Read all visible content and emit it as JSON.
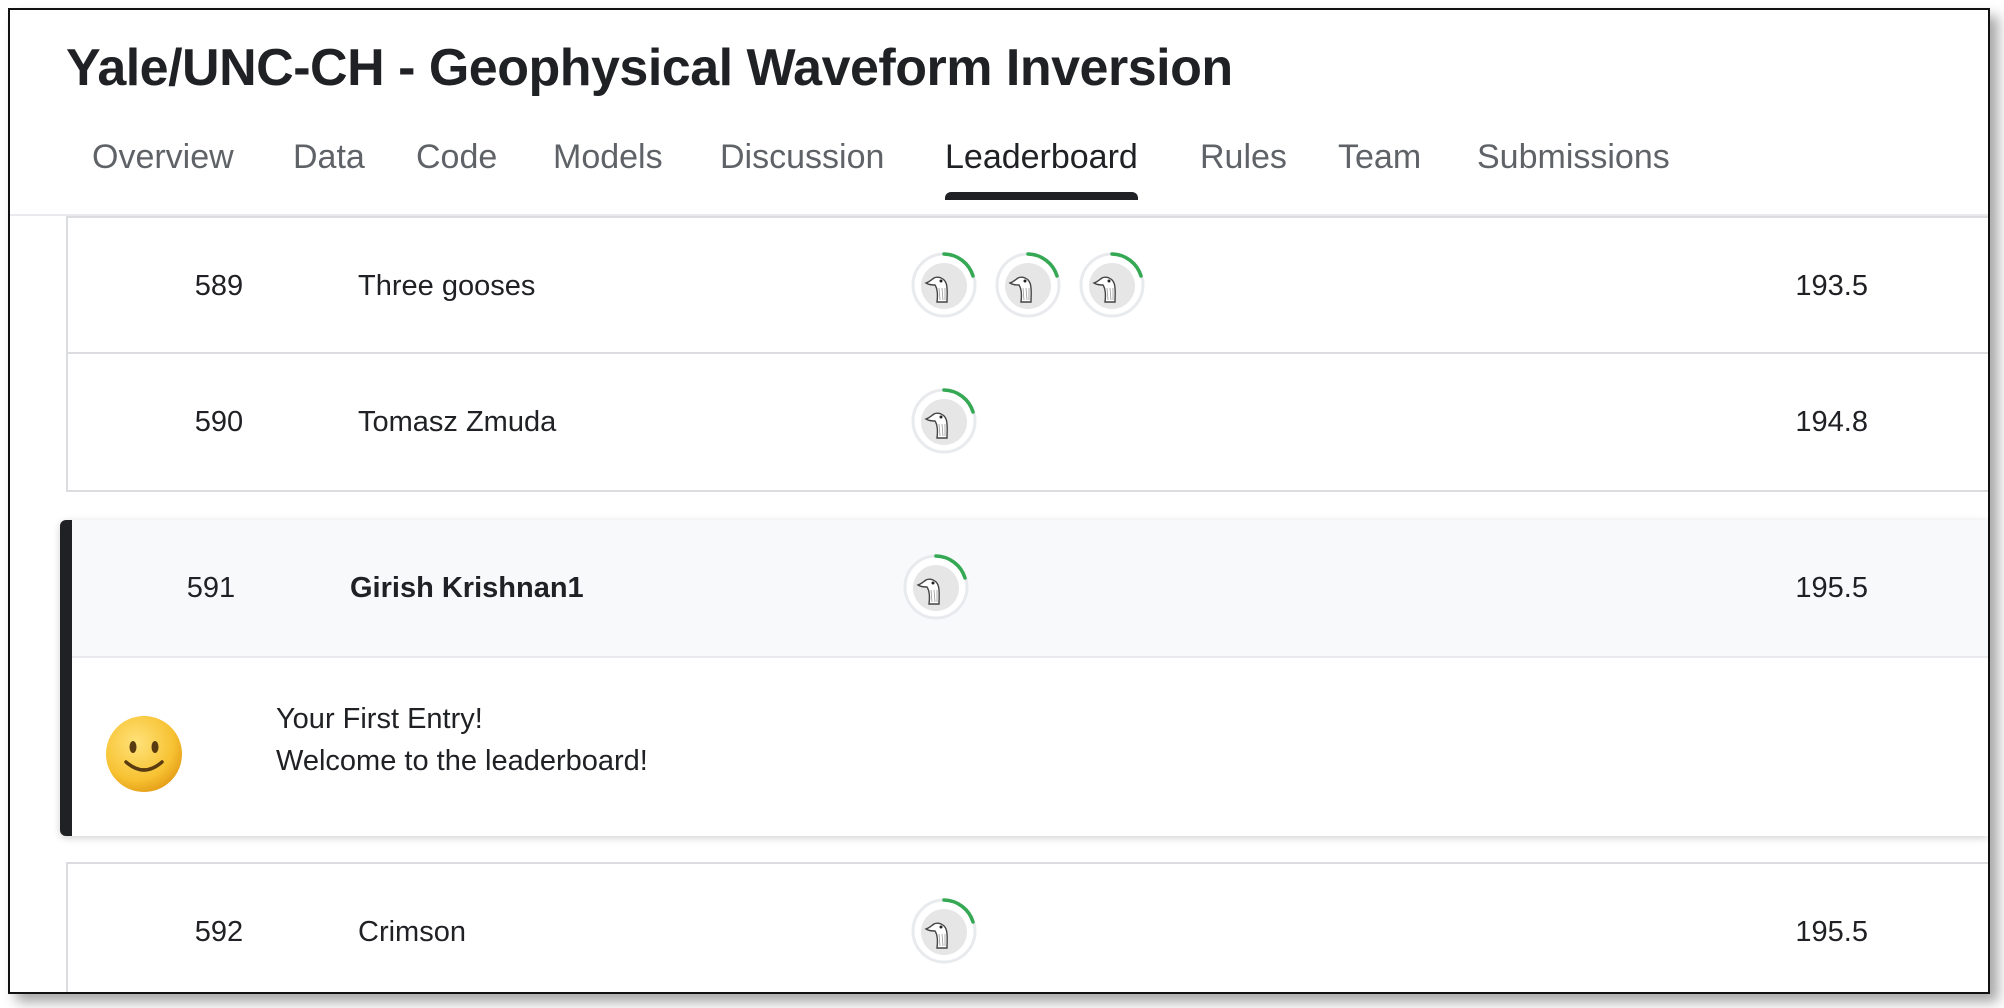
{
  "competition": {
    "title": "Yale/UNC-CH - Geophysical Waveform Inversion"
  },
  "tabs": [
    {
      "label": "Overview"
    },
    {
      "label": "Data"
    },
    {
      "label": "Code"
    },
    {
      "label": "Models"
    },
    {
      "label": "Discussion"
    },
    {
      "label": "Leaderboard",
      "active": true
    },
    {
      "label": "Rules"
    },
    {
      "label": "Team"
    },
    {
      "label": "Submissions"
    }
  ],
  "leaderboard": {
    "rows": [
      {
        "rank": "589",
        "team": "Three gooses",
        "score": "193.5",
        "members": 3,
        "member_icon": "goose-avatar-icon"
      },
      {
        "rank": "590",
        "team": "Tomasz Zmuda",
        "score": "194.8",
        "members": 1,
        "member_icon": "goose-avatar-icon"
      },
      {
        "rank": "591",
        "team": "Girish Krishnan1",
        "score": "195.5",
        "members": 1,
        "member_icon": "goose-avatar-icon",
        "current_user": true
      },
      {
        "rank": "592",
        "team": "Crimson",
        "score": "195.5",
        "members": 1,
        "member_icon": "goose-avatar-icon"
      }
    ],
    "first_entry": {
      "icon": "smiling-face-icon",
      "line1": "Your First Entry!",
      "line2": "Welcome to the leaderboard!"
    }
  },
  "colors": {
    "accent": "#202124",
    "progress_ring": "#34a853",
    "border": "#dadce0"
  }
}
